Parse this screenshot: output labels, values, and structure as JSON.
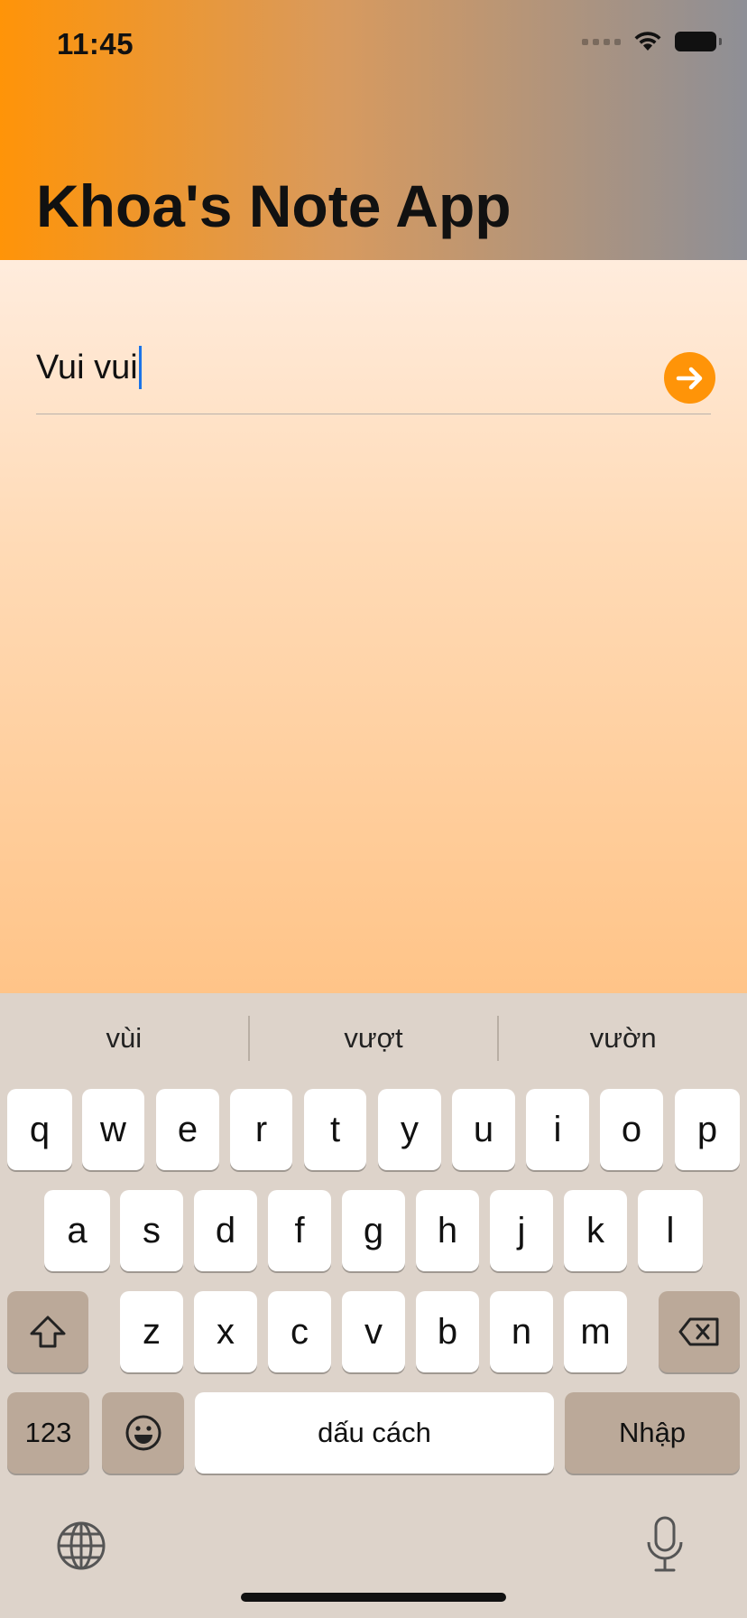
{
  "status_bar": {
    "time": "11:45"
  },
  "header": {
    "title": "Khoa's Note App"
  },
  "note": {
    "input_value": "Vui vui"
  },
  "keyboard": {
    "suggestions": [
      "vùi",
      "vượt",
      "vườn"
    ],
    "row1": [
      "q",
      "w",
      "e",
      "r",
      "t",
      "y",
      "u",
      "i",
      "o",
      "p"
    ],
    "row2": [
      "a",
      "s",
      "d",
      "f",
      "g",
      "h",
      "j",
      "k",
      "l"
    ],
    "row3": [
      "z",
      "x",
      "c",
      "v",
      "b",
      "n",
      "m"
    ],
    "numbers_label": "123",
    "space_label": "dấu cách",
    "return_label": "Nhập"
  },
  "colors": {
    "accent": "#ff9408",
    "keyboard_bg": "#ddd3ca",
    "dark_key": "#bba999"
  }
}
